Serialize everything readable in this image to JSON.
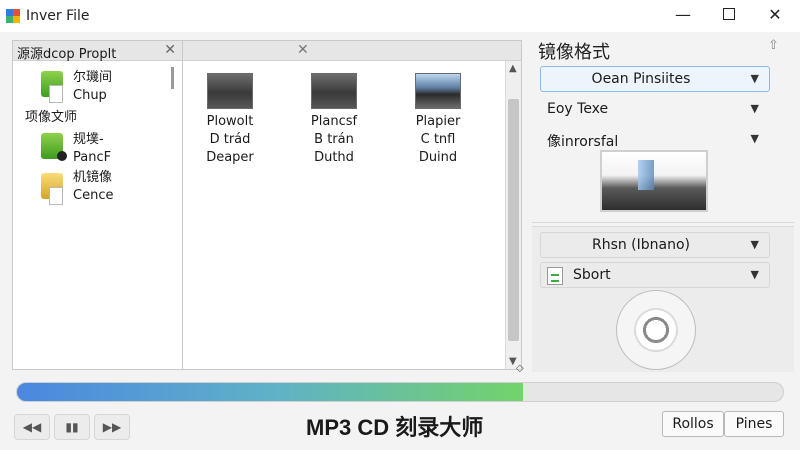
{
  "window": {
    "title": "Inver File",
    "controls": {
      "minimize": "—",
      "close": "✕"
    }
  },
  "left_pane": {
    "header": "源源dcop   Proplt",
    "close": "✕",
    "items": [
      {
        "line1": "尔璣间",
        "line2": "Chup",
        "icon": "green-folder-icon"
      },
      {
        "label": "项像文师"
      },
      {
        "line1": "规墣-",
        "line2": "PancF",
        "icon": "green-folder-badge-icon"
      },
      {
        "line1": "机镜像",
        "line2": "Cence",
        "icon": "yellow-folder-icon"
      }
    ]
  },
  "mid_pane": {
    "close": "✕",
    "files": [
      {
        "lines": [
          "Plowolt",
          "D trád",
          "Deaper"
        ],
        "thumb": "dark"
      },
      {
        "lines": [
          "Plancsf",
          "B trán",
          "Duthd"
        ],
        "thumb": "dark"
      },
      {
        "lines": [
          "Plapier",
          "C tnfl",
          "Duind"
        ],
        "thumb": "blue"
      }
    ],
    "scroll": {
      "up": "▲",
      "down": "▼"
    },
    "grip": "◇"
  },
  "right_panel": {
    "title": "镜像格式",
    "up_icon": "⇧",
    "dropdowns": [
      {
        "label": "Oean Pinsiites",
        "accent": true,
        "center": true
      },
      {
        "label": "Eoy Texe"
      },
      {
        "label": "像inrorsfal"
      }
    ],
    "lower_dropdowns": [
      {
        "label": "Rhsn (Ibnano)",
        "center": true
      },
      {
        "label": "Sbort",
        "icon": "sort-icon"
      }
    ],
    "caret": "▼"
  },
  "progress": {
    "fraction": 0.66
  },
  "bottom": {
    "prev": "◀◀",
    "pause": "▮▮",
    "next": "▶▶",
    "app_name": "MP3 CD 刻录大师",
    "buttons": [
      "Rollos",
      "Pines"
    ]
  }
}
